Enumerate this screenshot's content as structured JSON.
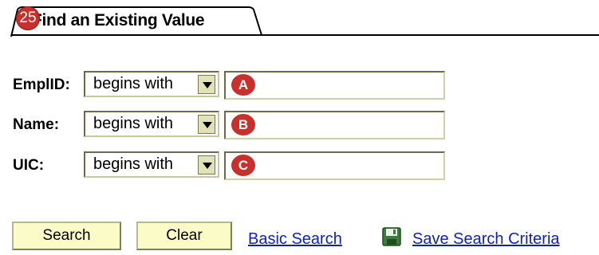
{
  "tab": {
    "title": "Find an Existing Value",
    "badge": "25"
  },
  "fields": [
    {
      "label": "EmplID:",
      "operator": "begins with",
      "value": "",
      "marker": "A"
    },
    {
      "label": "Name:",
      "operator": "begins with",
      "value": "",
      "marker": "B"
    },
    {
      "label": "UIC:",
      "operator": "begins with",
      "value": "",
      "marker": "C"
    }
  ],
  "actions": {
    "search_label": "Search",
    "clear_label": "Clear",
    "basic_search_label": "Basic Search",
    "save_criteria_label": "Save Search Criteria"
  },
  "colors": {
    "marker": "#c9302c",
    "button_bg": "#fbfbc8",
    "link": "#1020c0"
  },
  "icons": {
    "save": "floppy-disk-icon",
    "dropdown": "chevron-down-icon"
  }
}
